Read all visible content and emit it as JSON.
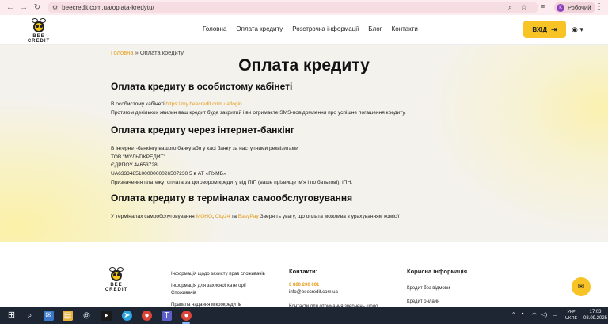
{
  "browser": {
    "url": "beecredit.com.ua/oplata-kredytu/",
    "profile_label": "Робочий",
    "profile_initial": "К"
  },
  "header": {
    "brand": "BEE CREDIT",
    "nav": [
      "Головна",
      "Оплата кредиту",
      "Розстрочка інформації",
      "Блог",
      "Контакти"
    ],
    "login_label": "ВХІД",
    "accent": "#f7c325"
  },
  "main": {
    "breadcrumb_home": "Головна",
    "breadcrumb_sep": " » ",
    "breadcrumb_current": "Оплата кредиту",
    "title": "Оплата кредиту",
    "section1": {
      "title": "Оплата кредиту в особистому кабінеті",
      "line1_prefix": "В особистому кабінеті ",
      "line1_link": "https://my.beecredit.com.ua/login",
      "line2": "Протягом декількох хвилин ваш кредит буде закритий і ви отримаєте SMS-повідомлення про успішне погашення кредиту."
    },
    "section2": {
      "title": "Оплата кредиту через інтернет-банкінг",
      "lines": [
        "В інтернет-банкінгу вашого банку або у касі банку за наступними реквізитами",
        "ТОВ \"МУЛЬТІКРЕДИТ\"",
        "ЄДРПОУ 44653728",
        "UA633348510000000026507230 5 в АТ «ПУМБ»",
        "Призначення платежу: сплата за договором кредиту від ПІП (ваше прізвище ім'я і по батькові), ІПН."
      ]
    },
    "section3": {
      "title": "Оплата кредиту в терміналах самообслуговування",
      "prefix": "У терміналах самообслуговування ",
      "link1": "МОНО",
      "sep1": ", ",
      "link2": "City24",
      "sep2": " та ",
      "link3": "EasyPay",
      "suffix": " Зверніть увагу, що оплата можлива з урахуванням комісії"
    }
  },
  "footer": {
    "brand": "BEE CREDIT",
    "col1": [
      "Інформація щодо захисту прав споживачів",
      "Інформація для захисної категорії",
      "Споживачів",
      "Правила надання мікрокредитів"
    ],
    "contacts_title": "Контакти:",
    "phone": "0 800 200 001",
    "email": "info@beecredit.com.ua",
    "contacts_more": "Контакти для отримання звернень щодо",
    "useful_title": "Корисна інформація",
    "useful": [
      "Кредит без відмови",
      "Кредит онлайн"
    ]
  },
  "taskbar": {
    "lang": "УКР",
    "lang2": "UKRE",
    "time": "17:03",
    "date": "08.09.2025"
  }
}
